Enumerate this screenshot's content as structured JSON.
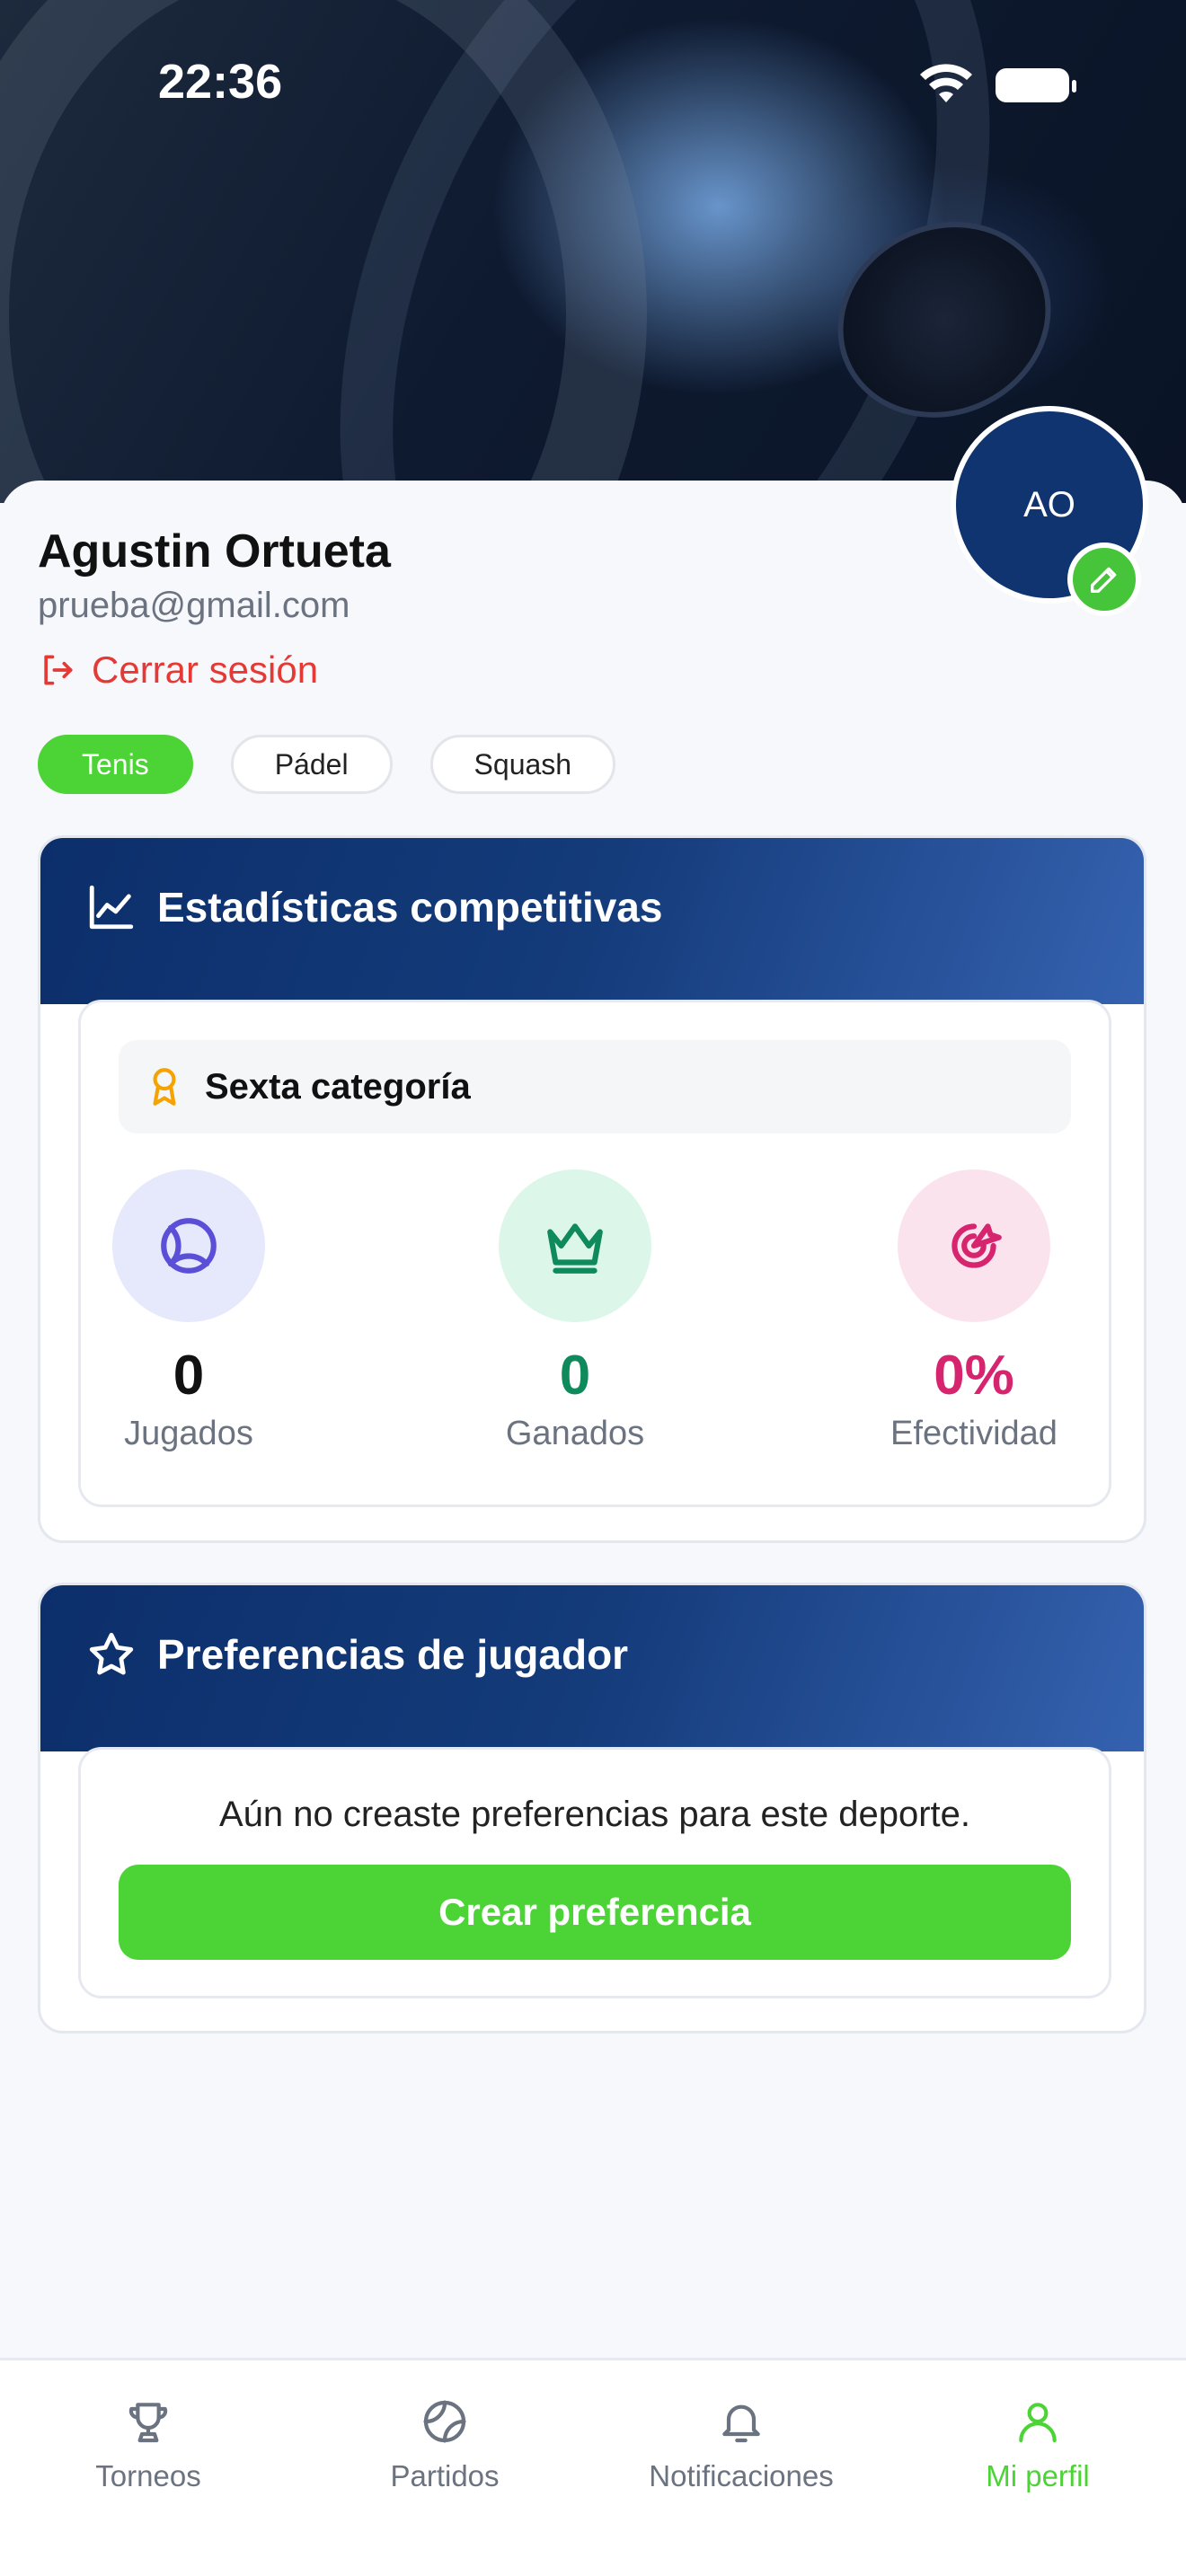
{
  "status_bar": {
    "time": "22:36"
  },
  "profile": {
    "initials": "AO",
    "name": "Agustin Ortueta",
    "email": "prueba@gmail.com",
    "logout_label": "Cerrar sesión"
  },
  "sports": {
    "selected": "Tenis",
    "items": [
      "Tenis",
      "Pádel",
      "Squash"
    ]
  },
  "stats_card": {
    "title": "Estadísticas competitivas",
    "category": "Sexta categoría",
    "played": {
      "value": "0",
      "label": "Jugados"
    },
    "won": {
      "value": "0",
      "label": "Ganados"
    },
    "effectiveness": {
      "value": "0%",
      "label": "Efectividad"
    }
  },
  "preferences_card": {
    "title": "Preferencias de jugador",
    "empty_message": "Aún no creaste preferencias para este deporte.",
    "create_button": "Crear preferencia"
  },
  "tab_bar": {
    "active": "Mi perfil",
    "items": [
      "Torneos",
      "Partidos",
      "Notificaciones",
      "Mi perfil"
    ]
  },
  "colors": {
    "accent_green": "#4cd436",
    "logout_red": "#e53935",
    "header_blue": "#0c2f6b",
    "played_purple": "#5a4fd6",
    "won_green": "#0f8a5c",
    "effectiveness_pink": "#d6246e"
  },
  "icons": {
    "logout": "logout-icon",
    "stats": "chart-line-icon",
    "category": "award-icon",
    "played": "tennis-ball-icon",
    "won": "crown-icon",
    "effectiveness": "target-icon",
    "preferences": "star-icon",
    "edit": "pencil-icon"
  }
}
